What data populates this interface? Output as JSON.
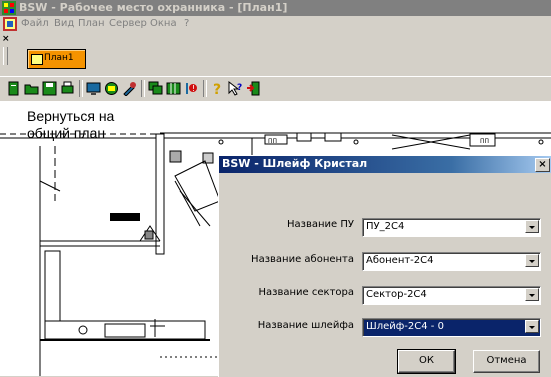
{
  "window": {
    "title": "BSW - Рабочее место охранника - [План1]"
  },
  "menu": {
    "items": [
      "Файл",
      "Вид",
      "План",
      "Сервер",
      "Окна",
      "?"
    ]
  },
  "tabs": [
    {
      "label": "План1"
    }
  ],
  "plan": {
    "back_label_line1": "Вернуться на",
    "back_label_line2": "общий план"
  },
  "dialog": {
    "title": "BSW - Шлейф Кристал",
    "close_label": "×",
    "fields": [
      {
        "label": "Название ПУ",
        "value": "ПУ_2С4"
      },
      {
        "label": "Название абонента",
        "value": "Абонент-2С4"
      },
      {
        "label": "Название сектора",
        "value": "Сектор-2С4"
      },
      {
        "label": "Название шлейфа",
        "value": "Шлейф-2С4 - 0"
      }
    ],
    "ok_label": "ОК",
    "cancel_label": "Отмена"
  },
  "colors": {
    "orange_tab": "#f59300",
    "dialog_title": "#0a246a",
    "selection": "#0a246a"
  }
}
